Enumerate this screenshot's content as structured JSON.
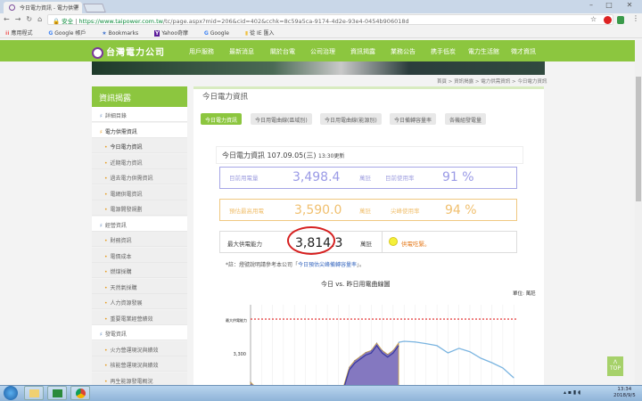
{
  "browser": {
    "tab_title": "今日電力資訊 - 電力供需",
    "url_secure": "安全",
    "url_host": "https://www.taipower.com.tw",
    "url_path": "/tc/page.aspx?mid=206&cid=402&cchk=8c59a5ca-9174-4d2e-93e4-0454b906018d",
    "bookmarks": [
      "應用程式",
      "Google 帳戶",
      "Bookmarks",
      "Yahoo奇摩",
      "Google",
      "從 IE 匯入"
    ]
  },
  "site": {
    "logo": "台灣電力公司",
    "nav": [
      "用戶服務",
      "最新消息",
      "關於台電",
      "公司治理",
      "資訊揭露",
      "業務公告",
      "携手低炭",
      "電力生活館",
      "徵才資訊"
    ],
    "breadcrumb": "首頁 > 資訊揭露 > 電力供需資訊 > 今日電力資訊"
  },
  "sidebar": {
    "title": "資訊揭露",
    "items": [
      {
        "label": "詳細目錄",
        "type": "cat"
      },
      {
        "label": "電力供需資訊",
        "type": "cat"
      },
      {
        "label": "今日電力資訊",
        "type": "sub"
      },
      {
        "label": "近期電力資訊",
        "type": "sub"
      },
      {
        "label": "過去電力供需資訊",
        "type": "sub"
      },
      {
        "label": "電網供電資訊",
        "type": "sub"
      },
      {
        "label": "電源開發規劃",
        "type": "sub"
      },
      {
        "label": "經營資訊",
        "type": "cat"
      },
      {
        "label": "財務資訊",
        "type": "sub"
      },
      {
        "label": "電價成本",
        "type": "sub"
      },
      {
        "label": "燃煤採購",
        "type": "sub"
      },
      {
        "label": "天然氣採購",
        "type": "sub"
      },
      {
        "label": "人力資源發展",
        "type": "sub"
      },
      {
        "label": "重要電業經營績效",
        "type": "sub"
      },
      {
        "label": "發電資訊",
        "type": "cat"
      },
      {
        "label": "火力營運現況與績效",
        "type": "sub"
      },
      {
        "label": "核能營運現況與績效",
        "type": "sub"
      },
      {
        "label": "再生能源發電概況",
        "type": "sub"
      }
    ]
  },
  "main": {
    "title": "今日電力資訊",
    "tabs": [
      "今日電力資訊",
      "今日用電曲線(區域別)",
      "今日用電曲線(能源別)",
      "今日備轉容量率",
      "各機組發電量"
    ],
    "info_title": "今日電力資訊 107.09.05(三)",
    "info_updated": "13:30更新",
    "current_label": "目前用電量",
    "current_value": "3,498.4",
    "unit": "萬瓩",
    "current_rate_label": "目前使用率",
    "current_rate": "91 %",
    "peak_label": "預估最高用電",
    "peak_value": "3,590.0",
    "peak_rate_label": "尖峰使用率",
    "peak_rate": "94 %",
    "capacity_label": "最大供電能力",
    "capacity_value": "3,814.3",
    "status": "供電吃緊。",
    "note_prefix": "*註：燈號說明請參考本公司「",
    "note_link": "今日預估尖峰備轉容量率",
    "note_suffix": "」。",
    "colors": {
      "green": "#8cc63f",
      "purple": "#8c8ce0",
      "orange": "#f0c070",
      "status": "#e67e22"
    }
  },
  "chart_data": {
    "type": "area",
    "title": "今日 vs. 昨日用電曲線圖",
    "unit_label": "單位: 萬瓩",
    "ytick_labels": [
      "最大供電能力",
      "3,300"
    ],
    "max_capacity": 3814.3,
    "xlim": [
      0,
      24
    ],
    "series": [
      {
        "name": "今日",
        "x": [
          0,
          0.5,
          8.5,
          9,
          9.5,
          10,
          10.5,
          11,
          11.5,
          12,
          12.5,
          13,
          13.5
        ],
        "values": [
          2880,
          2800,
          2830,
          3100,
          3200,
          3260,
          3320,
          3350,
          3460,
          3350,
          3290,
          3350,
          3460
        ]
      },
      {
        "name": "昨日",
        "x": [
          13.5,
          14,
          15,
          16,
          17,
          18,
          19,
          20,
          21,
          22,
          23,
          24
        ],
        "values": [
          3470,
          3485,
          3475,
          3450,
          3420,
          3313,
          3380,
          3330,
          3234,
          3168,
          3090,
          2944
        ]
      }
    ]
  },
  "taskbar": {
    "time": "13:34",
    "date": "2018/9/5"
  },
  "totop": "TOP"
}
